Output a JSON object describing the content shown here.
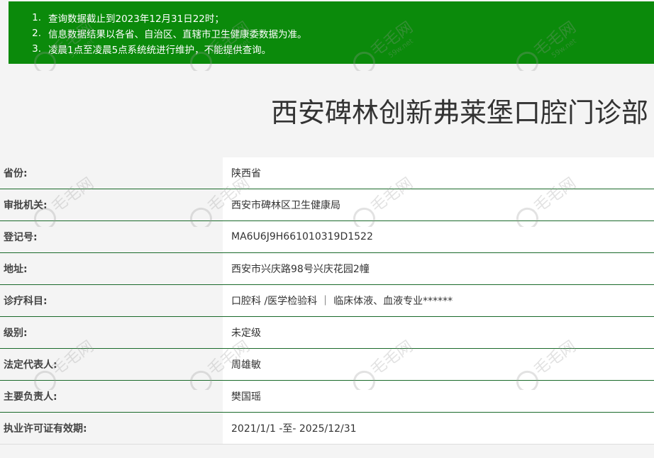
{
  "notice": {
    "items": [
      {
        "num": "1.",
        "text": "查询数据截止到2023年12月31日22时；"
      },
      {
        "num": "2.",
        "text": "信息数据结果以各省、自治区、直辖市卫生健康委数据为准。"
      },
      {
        "num": "3.",
        "text": "凌晨1点至凌晨5点系统统进行维护，不能提供查询。"
      }
    ]
  },
  "title": "西安碑林创新弗莱堡口腔门诊部",
  "rows": [
    {
      "label": "省份:",
      "value": "陕西省"
    },
    {
      "label": "审批机关:",
      "value": "西安市碑林区卫生健康局"
    },
    {
      "label": "登记号:",
      "value": "MA6U6J9H661010319D1522"
    },
    {
      "label": "地址:",
      "value": "西安市兴庆路98号兴庆花园2幢"
    },
    {
      "label": "诊疗科目:",
      "value": "口腔科 /医学检验科 ｜ 临床体液、血液专业******"
    },
    {
      "label": "级别:",
      "value": "未定级"
    },
    {
      "label": "法定代表人:",
      "value": "周雄敏"
    },
    {
      "label": "主要负责人:",
      "value": "樊国瑶"
    },
    {
      "label": "执业许可证有效期:",
      "value": "2021/1/1 -至- 2025/12/31"
    }
  ],
  "watermark": {
    "text": "毛毛网",
    "sub": "59w.net",
    "icon": "tooth-logo-icon"
  },
  "colors": {
    "notice_bg": "#0b8a0b",
    "row_border": "#1a6a2a"
  }
}
